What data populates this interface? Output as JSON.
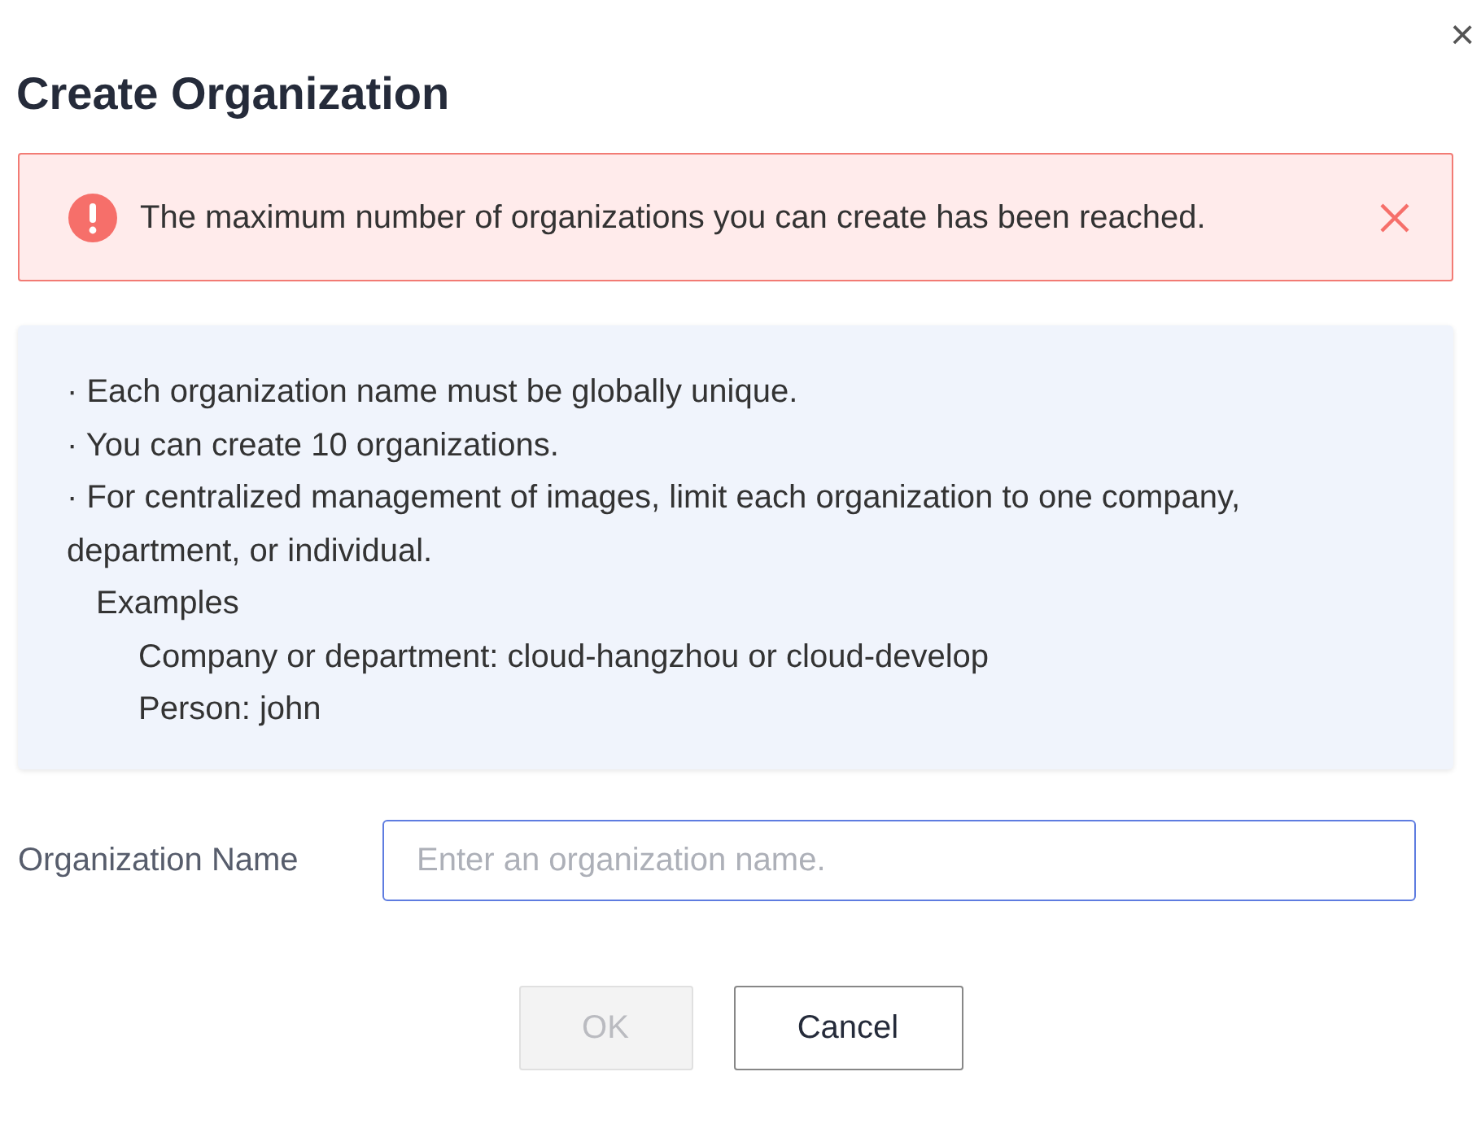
{
  "dialog": {
    "title": "Create Organization",
    "close_label": "×"
  },
  "alert": {
    "message": "The maximum number of organizations you can create has been reached."
  },
  "notes": [
    {
      "text": "· Each organization name must be globally unique."
    },
    {
      "text": "· You can create 10 organizations."
    },
    {
      "text": "· For centralized management of images, limit each organization to one company, department, or individual."
    },
    {
      "text": "Examples",
      "children": [
        {
          "text": "Company or department: cloud-hangzhou or cloud-develop"
        },
        {
          "text": "Person: john"
        }
      ]
    }
  ],
  "field": {
    "label": "Organization Name",
    "placeholder": "Enter an organization name."
  },
  "buttons": [
    {
      "label": "OK",
      "disabled": true
    },
    {
      "label": "Cancel",
      "disabled": false
    }
  ]
}
